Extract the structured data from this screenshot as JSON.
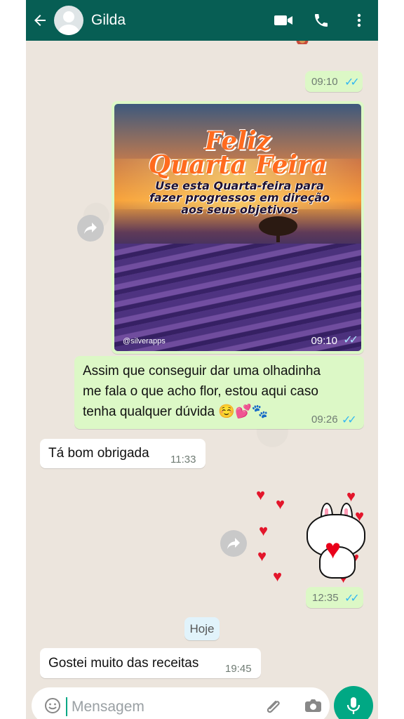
{
  "contact": {
    "name": "Gilda"
  },
  "messages": [
    {
      "time": "09:10",
      "ticks": "✓✓"
    },
    {
      "image": {
        "title_line1": "Feliz",
        "title_line2": "Quarta Feira",
        "subtitle": "Use esta Quarta-feira para fazer progressos em direção aos seus objetivos",
        "watermark": "@silverapps",
        "time": "09:10",
        "ticks": "✓✓"
      }
    },
    {
      "line1": "Assim que conseguir dar uma olhadinha",
      "line2": "me fala o que acho flor, estou aqui caso",
      "line3": "tenha qualquer dúvida ☺️💕🐾",
      "time": "09:26",
      "ticks": "✓✓"
    },
    {
      "text": "Tá bom obrigada",
      "time": "11:33"
    },
    {
      "time": "12:35",
      "ticks": "✓✓"
    },
    {
      "date": "Hoje"
    },
    {
      "text": "Gostei muito das receitas",
      "time": "19:45"
    }
  ],
  "composer": {
    "placeholder": "Mensagem"
  },
  "icons": {
    "back": "arrow-left-icon",
    "video": "video-icon",
    "call": "phone-icon",
    "menu": "more-vert-icon",
    "emoji": "emoji-icon",
    "attach": "paperclip-icon",
    "camera": "camera-icon",
    "mic": "microphone-icon"
  },
  "colors": {
    "header": "#075e54",
    "outgoing": "#dcf8c6",
    "incoming": "#ffffff",
    "accent": "#00a884",
    "read_ticks": "#34b7f1"
  }
}
